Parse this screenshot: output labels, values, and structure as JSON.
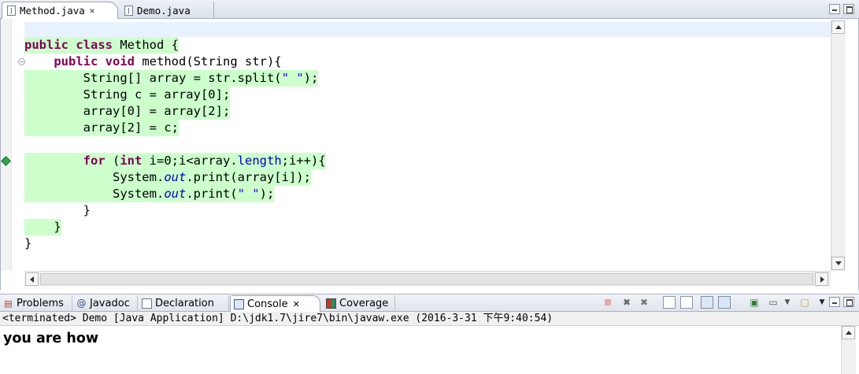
{
  "editor": {
    "tabs": [
      {
        "label": "Method.java",
        "close": "✕",
        "active": true,
        "icon": "java-file-icon"
      },
      {
        "label": "Demo.java",
        "active": false,
        "icon": "java-file-icon"
      }
    ],
    "code_lines": [
      {
        "segments": [],
        "covered": false
      },
      {
        "segments": [
          {
            "t": "public",
            "c": "kw"
          },
          {
            "t": " "
          },
          {
            "t": "class",
            "c": "kw"
          },
          {
            "t": " Method {"
          }
        ],
        "covered": true
      },
      {
        "segments": [
          {
            "t": "    "
          },
          {
            "t": "public",
            "c": "kw"
          },
          {
            "t": " "
          },
          {
            "t": "void",
            "c": "kw"
          },
          {
            "t": " method(String str){"
          }
        ],
        "covered": false
      },
      {
        "segments": [
          {
            "t": "        String[] array = str.split("
          },
          {
            "t": "\" \"",
            "c": "str"
          },
          {
            "t": ");"
          }
        ],
        "covered": true
      },
      {
        "segments": [
          {
            "t": "        String c = array[0];"
          }
        ],
        "covered": true
      },
      {
        "segments": [
          {
            "t": "        array[0] = array[2];"
          }
        ],
        "covered": true
      },
      {
        "segments": [
          {
            "t": "        array[2] = c;"
          }
        ],
        "covered": true
      },
      {
        "segments": [],
        "covered": false
      },
      {
        "segments": [
          {
            "t": "        "
          },
          {
            "t": "for",
            "c": "kw"
          },
          {
            "t": " ("
          },
          {
            "t": "int",
            "c": "kw"
          },
          {
            "t": " i=0;i<array."
          },
          {
            "t": "length",
            "c": "fld"
          },
          {
            "t": ";i++){"
          }
        ],
        "covered": true
      },
      {
        "segments": [
          {
            "t": "            System."
          },
          {
            "t": "out",
            "c": "sfld"
          },
          {
            "t": ".print(array[i]);"
          }
        ],
        "covered": true
      },
      {
        "segments": [
          {
            "t": "            System."
          },
          {
            "t": "out",
            "c": "sfld"
          },
          {
            "t": ".print("
          },
          {
            "t": "\" \"",
            "c": "str"
          },
          {
            "t": ");"
          }
        ],
        "covered": true
      },
      {
        "segments": [
          {
            "t": "        }"
          }
        ],
        "covered": false
      },
      {
        "segments": [
          {
            "t": "    }"
          }
        ],
        "covered": true
      },
      {
        "segments": [
          {
            "t": "}"
          }
        ],
        "covered": false
      }
    ],
    "fold_markers": [
      {
        "line": 2,
        "symbol": "⊖"
      }
    ],
    "breakpoint_markers": [
      {
        "line": 8
      }
    ]
  },
  "panel": {
    "tabs": [
      {
        "label": "Problems",
        "icon": "problems-icon"
      },
      {
        "label": "Javadoc",
        "icon": "javadoc-icon",
        "glyph": "@"
      },
      {
        "label": "Declaration",
        "icon": "declaration-icon"
      },
      {
        "label": "Console",
        "icon": "console-icon",
        "close": "✕",
        "active": true
      },
      {
        "label": "Coverage",
        "icon": "coverage-icon"
      }
    ],
    "toolbar_icons": [
      "terminate-icon",
      "remove-launch-icon",
      "remove-all-icon",
      "scroll-lock-icon",
      "show-stdout-icon",
      "pin-console-icon",
      "word-wrap-icon",
      "display-console-icon",
      "open-console-icon",
      "new-console-icon",
      "view-menu-icon"
    ],
    "console_status": "<terminated> Demo [Java Application] D:\\jdk1.7\\jire7\\bin\\javaw.exe (2016-3-31 下午9:40:54)",
    "console_output": "you are how"
  },
  "colors": {
    "coverage_green": "#ccffcc",
    "keyword": "#7f0055",
    "string": "#2a00ff",
    "field": "#0000c0",
    "current_line": "#e8f2fe"
  }
}
